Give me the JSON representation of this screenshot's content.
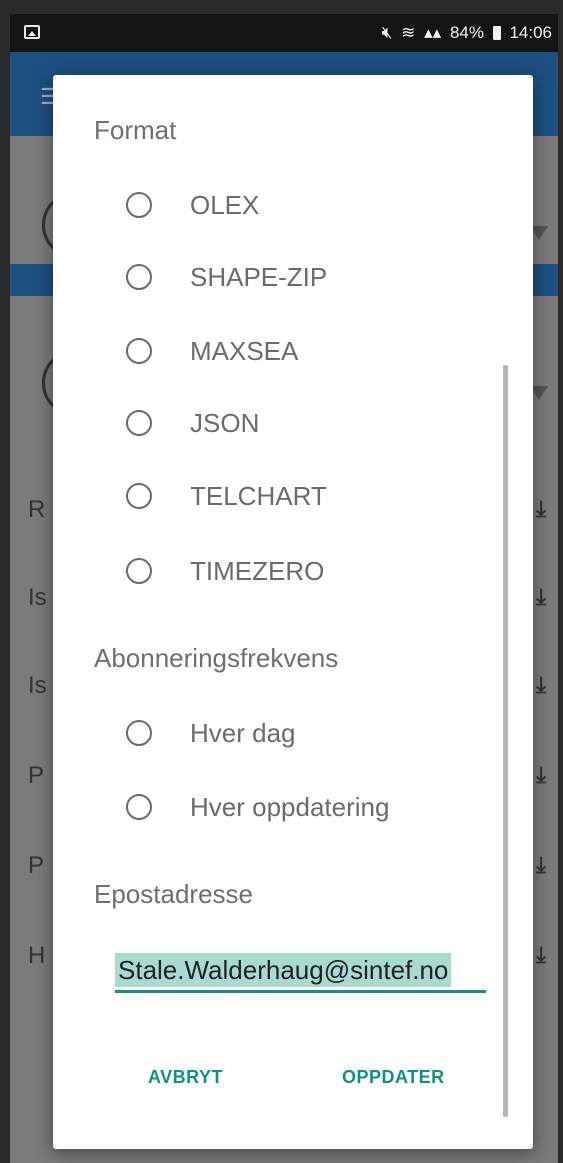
{
  "status_bar": {
    "battery": "84%",
    "time": "14:06"
  },
  "background": {
    "row_letters": [
      "R",
      "Is",
      "Is",
      "P",
      "P",
      "H"
    ]
  },
  "dialog": {
    "format_title": "Format",
    "format_options": [
      "OLEX",
      "SHAPE-ZIP",
      "MAXSEA",
      "JSON",
      "TELCHART",
      "TIMEZERO"
    ],
    "frequency_title": "Abonneringsfrekvens",
    "frequency_options": [
      "Hver dag",
      "Hver oppdatering"
    ],
    "email_title": "Epostadresse",
    "email_value": "Stale.Walderhaug@sintef.no",
    "cancel_label": "AVBRYT",
    "update_label": "OPPDATER"
  },
  "colors": {
    "accent": "#13907f",
    "appbar": "#1d4f80",
    "selection": "#a9dad2"
  }
}
